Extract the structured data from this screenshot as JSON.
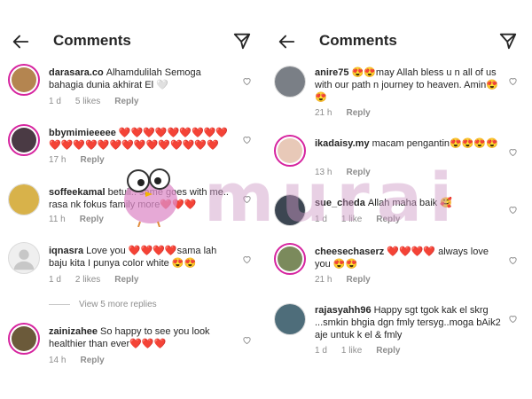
{
  "header": {
    "title": "Comments"
  },
  "colors": {
    "ring": "#d6249f",
    "meta": "#8e8e8e",
    "watermark": "#cd96c3"
  },
  "watermark": {
    "text": "murai"
  },
  "left": {
    "comments": [
      {
        "user": "darasara.co",
        "text": "Alhamdulilah Semoga bahagia dunia akhirat El 🤍",
        "time": "1 d",
        "likes": "5 likes",
        "reply": "Reply"
      },
      {
        "user": "bbymimieeeee",
        "text": "❤️❤️❤️❤️❤️❤️❤️❤️❤️❤️❤️❤️❤️❤️❤️❤️❤️❤️❤️❤️❤️❤️❤️",
        "time": "17 h",
        "likes": "",
        "reply": "Reply"
      },
      {
        "user": "soffeekamal",
        "text": "betull.. same goes with me.. rasa nk fokus family more❤️❤️❤️",
        "time": "11 h",
        "likes": "",
        "reply": "Reply"
      },
      {
        "user": "iqnasra",
        "text": "Love you ❤️❤️❤️❤️sama lah baju kita I punya color white 😍😍",
        "time": "1 d",
        "likes": "2 likes",
        "reply": "Reply"
      },
      {
        "user": "zainizahee",
        "text": "So happy to see you look healthier than ever❤️❤️❤️",
        "time": "14 h",
        "likes": "",
        "reply": "Reply"
      }
    ],
    "view_more": "View 5 more replies"
  },
  "right": {
    "comments": [
      {
        "user": "anire75",
        "text": "😍😍may Allah bless u n all of us with our path n journey to heaven. Amin😍😍",
        "time": "21 h",
        "likes": "",
        "reply": "Reply"
      },
      {
        "user": "ikadaisy.my",
        "text": "macam pengantin😍😍😍😍",
        "time": "13 h",
        "likes": "",
        "reply": "Reply"
      },
      {
        "user": "sue_cheda",
        "text": "Allah maha baik 🥰",
        "time": "1 d",
        "likes": "1 like",
        "reply": "Reply"
      },
      {
        "user": "cheesechaserz",
        "text": "❤️❤️❤️❤️ always love you 😍😍",
        "time": "21 h",
        "likes": "",
        "reply": "Reply"
      },
      {
        "user": "rajasyahh96",
        "text": "Happy sgt tgok kak el skrg ...smkin bhgia dgn fmly tersyg..moga bAik2 aje untuk k el & fmly",
        "time": "1 d",
        "likes": "1 like",
        "reply": "Reply"
      }
    ]
  }
}
